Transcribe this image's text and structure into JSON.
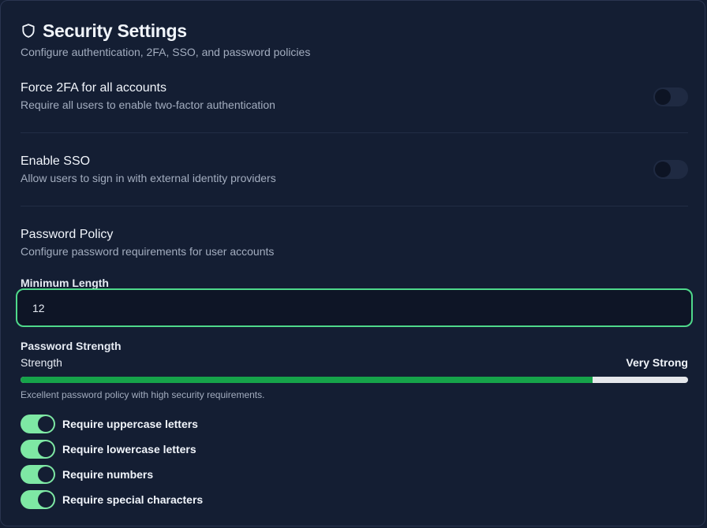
{
  "header": {
    "icon": "shield-icon",
    "title": "Security Settings",
    "subtitle": "Configure authentication, 2FA, SSO, and password policies"
  },
  "settings": [
    {
      "title": "Force 2FA for all accounts",
      "description": "Require all users to enable two-factor authentication",
      "enabled": false
    },
    {
      "title": "Enable SSO",
      "description": "Allow users to sign in with external identity providers",
      "enabled": false
    }
  ],
  "password_policy": {
    "title": "Password Policy",
    "description": "Configure password requirements for user accounts",
    "min_length_label": "Minimum Length",
    "min_length_value": "12",
    "strength_heading": "Password Strength",
    "strength_label": "Strength",
    "strength_value": "Very Strong",
    "strength_fraction": 0.857,
    "strength_hint": "Excellent password policy with high security requirements.",
    "requirements": [
      {
        "label": "Require uppercase letters",
        "enabled": true
      },
      {
        "label": "Require lowercase letters",
        "enabled": true
      },
      {
        "label": "Require numbers",
        "enabled": true
      },
      {
        "label": "Require special characters",
        "enabled": true
      }
    ]
  },
  "colors": {
    "background": "#141e33",
    "accent_green": "#4fd98b",
    "toggle_on": "#7ee8a4",
    "toggle_off": "#1f2a42",
    "strength_fill": "#16a34a",
    "strength_track": "#e5e7eb"
  }
}
